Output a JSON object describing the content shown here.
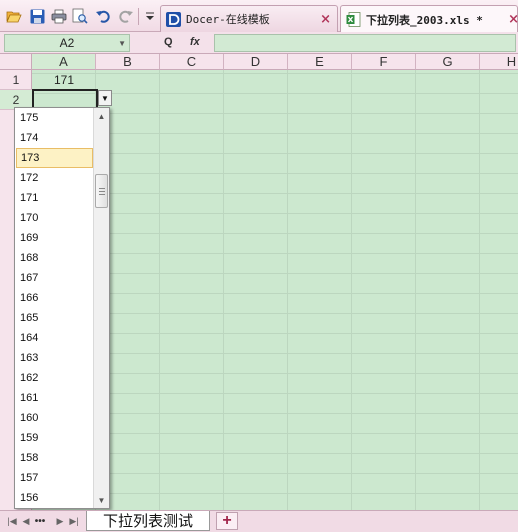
{
  "toolbar": {
    "icons": [
      "open-icon",
      "save-icon",
      "print-icon",
      "print-preview-icon",
      "undo-icon",
      "redo-icon",
      "customize-dropdown-icon"
    ]
  },
  "tabs": [
    {
      "label": "Docer-在线模板",
      "close": "×",
      "active": false
    },
    {
      "label": "下拉列表_2003.xls *",
      "close": "×",
      "active": true
    }
  ],
  "formula_bar": {
    "name_box": "A2",
    "zoom_icon": "Q",
    "fx_label": "fx",
    "formula": ""
  },
  "columns": [
    "A",
    "B",
    "C",
    "D",
    "E",
    "F",
    "G",
    "H"
  ],
  "rows": [
    "1",
    "2"
  ],
  "cells": {
    "A1": "171",
    "A2": ""
  },
  "dropdown": {
    "items": [
      "175",
      "174",
      "173",
      "172",
      "171",
      "170",
      "169",
      "168",
      "167",
      "166",
      "165",
      "164",
      "163",
      "162",
      "161",
      "160",
      "159",
      "158",
      "157",
      "156"
    ],
    "highlighted": "173"
  },
  "sheet": {
    "tab_label": "下拉列表测试",
    "add_label": "+"
  },
  "colors": {
    "cell_bg": "#cce8cf",
    "chrome_bg": "#f4dfe9",
    "close_x": "#b1365b",
    "highlight": "#fdf2c5"
  }
}
